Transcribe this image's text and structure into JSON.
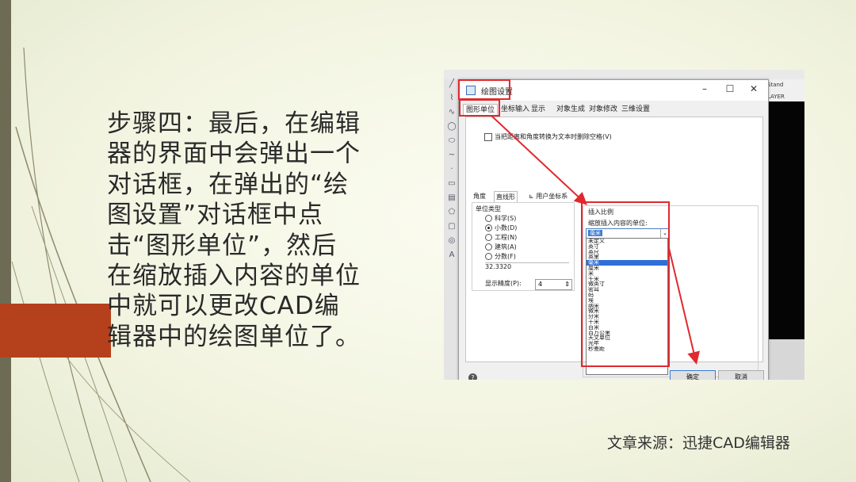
{
  "slide": {
    "body_text": "步骤四：最后，在编辑器的界面中会弹出一个对话框，在弹出的“绘图设置”对话框中点击“图形单位”，然后在缩放插入内容的单位中就可以更改CAD编辑器中的绘图单位了。",
    "source": "文章来源：迅捷CAD编辑器",
    "accent_color": "#b5411c"
  },
  "dialog": {
    "title": "绘图设置",
    "tabs": [
      "图形单位",
      "坐标输入",
      "显示",
      "对象生成",
      "对象修改",
      "三维设置"
    ],
    "checkbox_label": "当把距离和角度转换为文本时删除空格(V)",
    "subtabs": [
      "角度",
      "直线形",
      "用户坐标系"
    ],
    "unit_type_label": "单位类型",
    "unit_types": [
      "科学(S)",
      "小数(D)",
      "工程(N)",
      "建筑(A)",
      "分数(F)"
    ],
    "selected_unit_type": "小数(D)",
    "sample_value": "32.3320",
    "precision_label": "显示精度(P):",
    "precision_value": "4",
    "insert_scale_label": "插入比例",
    "insert_units_label": "缩放插入内容的单位:",
    "insert_units_selected": "毫米",
    "insert_units_options": [
      "未定义",
      "英寸",
      "英尺",
      "英里",
      "毫米",
      "厘米",
      "米",
      "千米",
      "微英寸",
      "密耳",
      "码",
      "埃",
      "纳米",
      "微米",
      "分米",
      "十米",
      "百米",
      "百万公里",
      "天文单位",
      "光年",
      "秒差距"
    ],
    "ok_label": "确定",
    "cancel_label": "取消",
    "help_icon": "?"
  },
  "app": {
    "layer_label": "LAYER",
    "right_label": "Stand"
  }
}
